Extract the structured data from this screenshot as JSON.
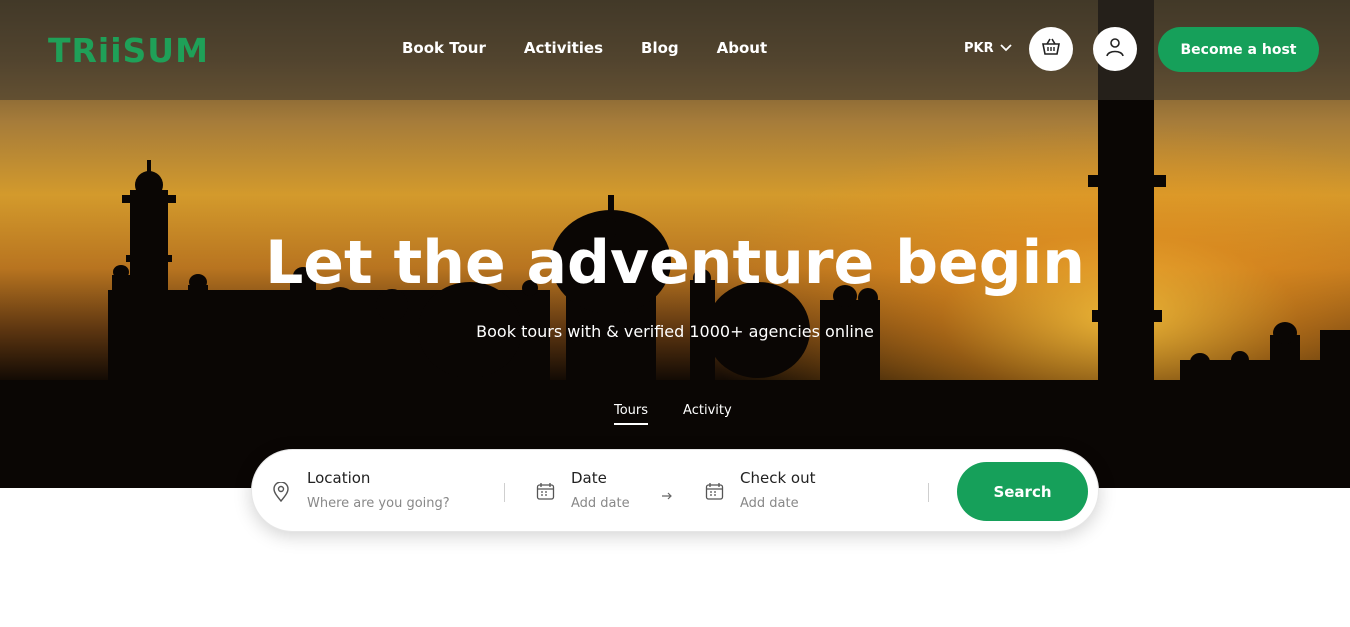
{
  "brand": {
    "logo_text": "TRiiSUM",
    "accent": "#16a05a"
  },
  "nav": {
    "links": [
      "Book Tour",
      "Activities",
      "Blog",
      "About"
    ],
    "currency": "PKR",
    "cart_icon": "basket-icon",
    "user_icon": "user-icon",
    "host_label": "Become a host"
  },
  "hero": {
    "headline": "Let the adventure begin",
    "subline": "Book tours with & verified 1000+ agencies online",
    "tabs": [
      "Tours",
      "Activity"
    ],
    "active_tab": "Tours"
  },
  "search": {
    "location_label": "Location",
    "location_placeholder": "Where are you going?",
    "date_label": "Date",
    "date_placeholder": "Add date",
    "checkout_label": "Check out",
    "checkout_placeholder": "Add date",
    "button_label": "Search"
  }
}
